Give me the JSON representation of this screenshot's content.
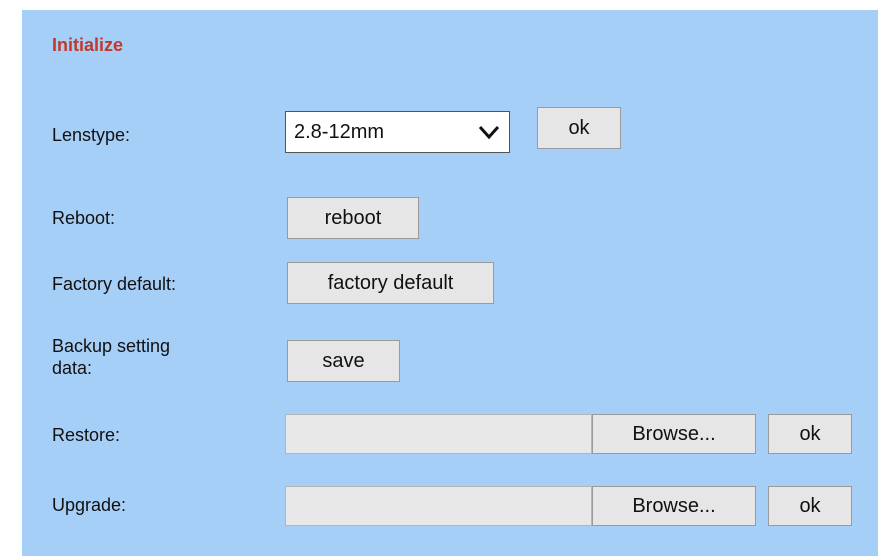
{
  "section": {
    "title": "Initialize"
  },
  "lenstype": {
    "label": "Lenstype:",
    "selected": "2.8-12mm",
    "ok_label": "ok"
  },
  "reboot": {
    "label": "Reboot:",
    "button_label": "reboot"
  },
  "factory": {
    "label": "Factory default:",
    "button_label": "factory default"
  },
  "backup": {
    "label_line1": "Backup setting",
    "label_line2": "data:",
    "button_label": "save"
  },
  "restore": {
    "label": "Restore:",
    "file_value": "",
    "browse_label": "Browse...",
    "ok_label": "ok"
  },
  "upgrade": {
    "label": "Upgrade:",
    "file_value": "",
    "browse_label": "Browse...",
    "ok_label": "ok"
  },
  "colors": {
    "panel_bg": "#a6cff8",
    "title": "#c0392b",
    "button_bg": "#e6e6e6"
  }
}
